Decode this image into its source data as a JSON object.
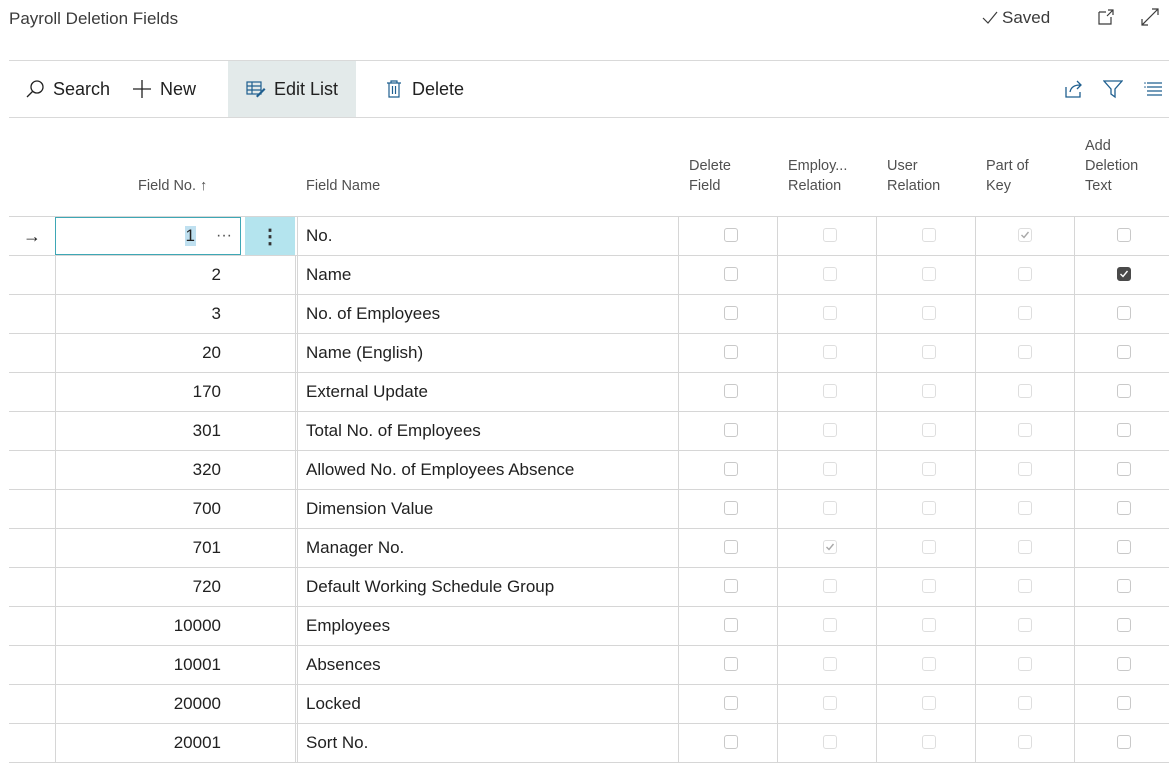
{
  "title": "Payroll Deletion Fields",
  "status": "Saved",
  "actions": {
    "search": "Search",
    "new": "New",
    "edit_list": "Edit List",
    "delete": "Delete"
  },
  "columns": {
    "field_no": "Field No. ↑",
    "field_name": "Field Name",
    "delete_field": [
      "Delete",
      "Field"
    ],
    "employ_relation": [
      "Employ...",
      "Relation"
    ],
    "user_relation": [
      "User",
      "Relation"
    ],
    "part_of_key": [
      "Part of",
      "Key"
    ],
    "add_deletion_text": [
      "Add",
      "Deletion",
      "Text"
    ]
  },
  "rows": [
    {
      "no": "1",
      "name": "No.",
      "delete_field": false,
      "employ_relation": false,
      "user_relation": false,
      "part_of_key": true,
      "add_deletion_text": false
    },
    {
      "no": "2",
      "name": "Name",
      "delete_field": false,
      "employ_relation": false,
      "user_relation": false,
      "part_of_key": false,
      "add_deletion_text": true
    },
    {
      "no": "3",
      "name": "No. of Employees",
      "delete_field": false,
      "employ_relation": false,
      "user_relation": false,
      "part_of_key": false,
      "add_deletion_text": false
    },
    {
      "no": "20",
      "name": "Name (English)",
      "delete_field": false,
      "employ_relation": false,
      "user_relation": false,
      "part_of_key": false,
      "add_deletion_text": false
    },
    {
      "no": "170",
      "name": "External Update",
      "delete_field": false,
      "employ_relation": false,
      "user_relation": false,
      "part_of_key": false,
      "add_deletion_text": false
    },
    {
      "no": "301",
      "name": "Total No. of Employees",
      "delete_field": false,
      "employ_relation": false,
      "user_relation": false,
      "part_of_key": false,
      "add_deletion_text": false
    },
    {
      "no": "320",
      "name": "Allowed No. of Employees Absence",
      "delete_field": false,
      "employ_relation": false,
      "user_relation": false,
      "part_of_key": false,
      "add_deletion_text": false
    },
    {
      "no": "700",
      "name": "Dimension Value",
      "delete_field": false,
      "employ_relation": false,
      "user_relation": false,
      "part_of_key": false,
      "add_deletion_text": false
    },
    {
      "no": "701",
      "name": "Manager No.",
      "delete_field": false,
      "employ_relation": true,
      "user_relation": false,
      "part_of_key": false,
      "add_deletion_text": false
    },
    {
      "no": "720",
      "name": "Default Working Schedule Group",
      "delete_field": false,
      "employ_relation": false,
      "user_relation": false,
      "part_of_key": false,
      "add_deletion_text": false
    },
    {
      "no": "10000",
      "name": "Employees",
      "delete_field": false,
      "employ_relation": false,
      "user_relation": false,
      "part_of_key": false,
      "add_deletion_text": false
    },
    {
      "no": "10001",
      "name": "Absences",
      "delete_field": false,
      "employ_relation": false,
      "user_relation": false,
      "part_of_key": false,
      "add_deletion_text": false
    },
    {
      "no": "20000",
      "name": "Locked",
      "delete_field": false,
      "employ_relation": false,
      "user_relation": false,
      "part_of_key": false,
      "add_deletion_text": false
    },
    {
      "no": "20001",
      "name": "Sort No.",
      "delete_field": false,
      "employ_relation": false,
      "user_relation": false,
      "part_of_key": false,
      "add_deletion_text": false
    }
  ],
  "colors": {
    "selection_border": "#3ea7b5",
    "row_menu_bg": "#b4e4ee",
    "edit_list_bg": "#e3eaea"
  },
  "icons": [
    "search-icon",
    "plus-icon",
    "edit-list-icon",
    "trash-icon",
    "share-icon",
    "filter-icon",
    "list-view-icon",
    "open-new-window-icon",
    "expand-icon",
    "checkmark-icon",
    "arrow-right-icon"
  ]
}
